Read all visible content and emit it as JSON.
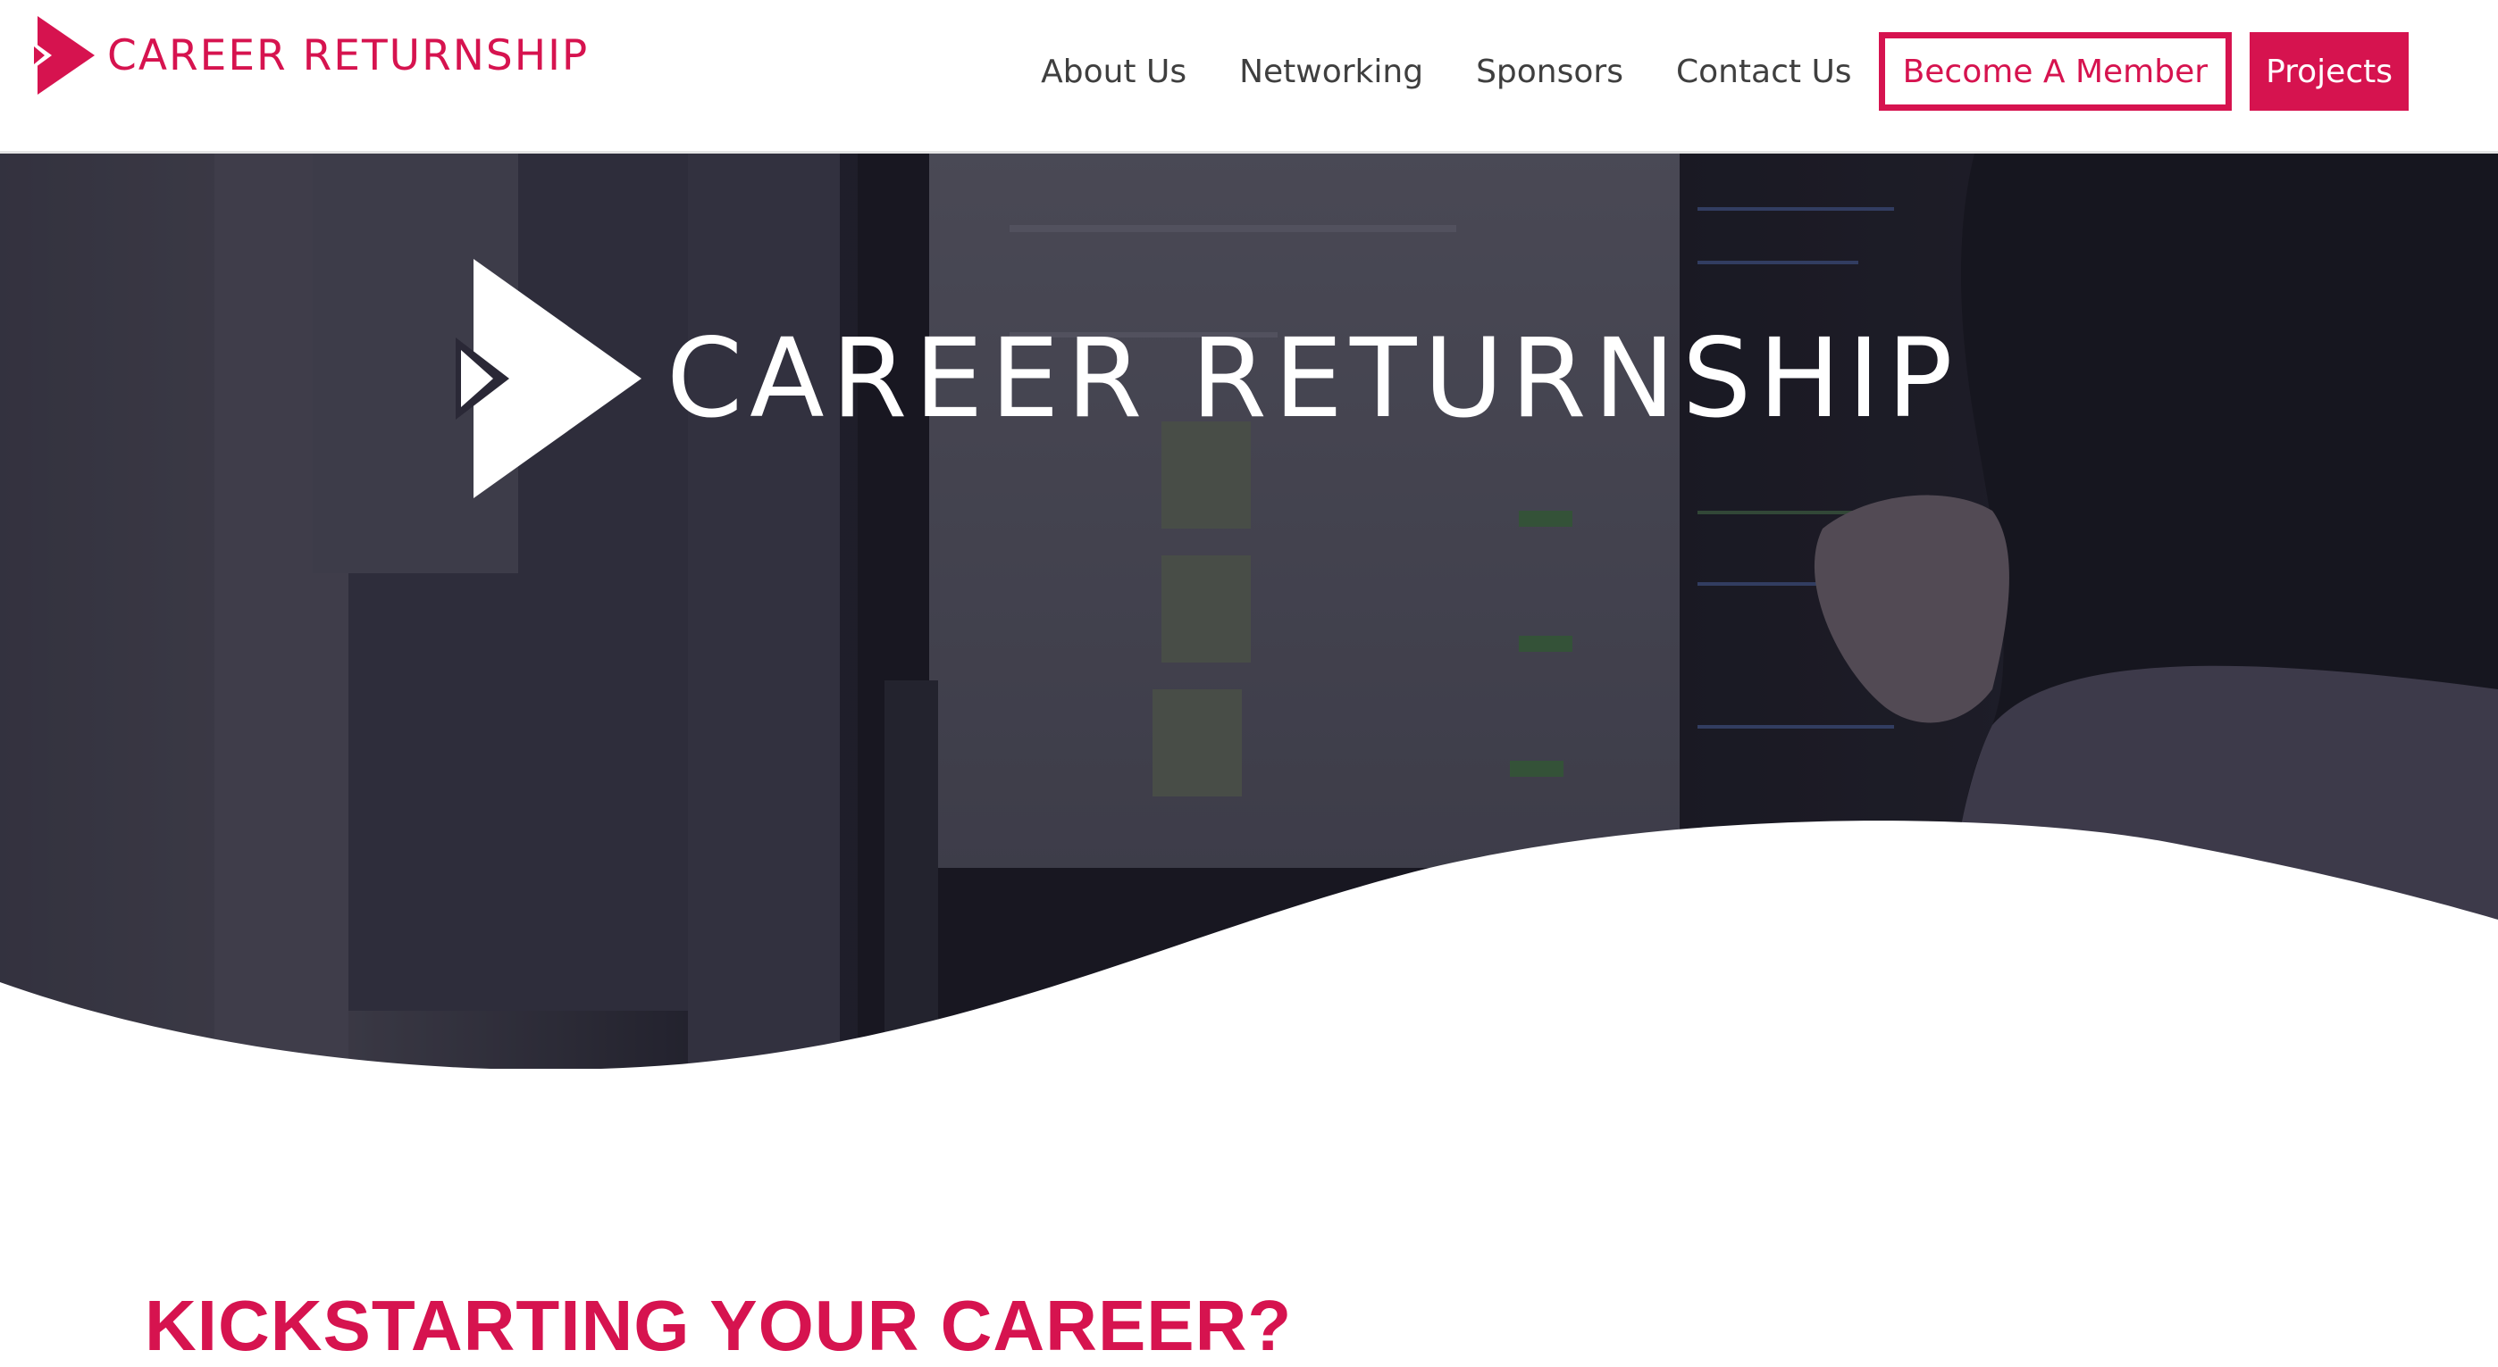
{
  "header": {
    "brand_name": "CAREER RETURNSHIP",
    "nav": {
      "about": "About Us",
      "networking": "Networking",
      "sponsors": "Sponsors",
      "contact": "Contact Us",
      "become_member": "Become A Member",
      "projects": "Projects"
    }
  },
  "hero": {
    "title": "CAREER RETURNSHIP"
  },
  "main": {
    "heading": "KICKSTARTING YOUR CAREER?"
  },
  "colors": {
    "brand": "#d6134f",
    "nav_text": "#3f3f3f",
    "hero_overlay": "#2a2836"
  },
  "icons": {
    "brand_logo": "play-arrow-logo-icon",
    "hero_logo": "play-arrow-logo-icon"
  }
}
